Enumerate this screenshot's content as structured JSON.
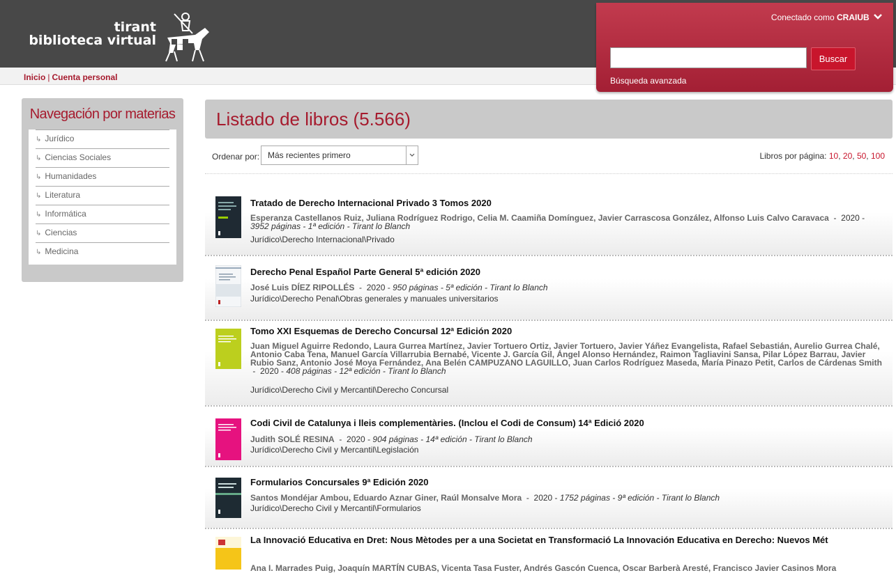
{
  "header": {
    "logo_line1": "tirant",
    "logo_line2": "biblioteca virtual",
    "user_prefix": "Conectado como",
    "user_name": "CRAIUB",
    "search_placeholder": "",
    "search_button": "Buscar",
    "advanced_search": "Búsqueda avanzada"
  },
  "breadcrumb": {
    "home": "Inicio",
    "separator": "|",
    "account": "Cuenta personal"
  },
  "sidebar": {
    "title": "Navegación por materias",
    "items": [
      {
        "label": "Jurídico"
      },
      {
        "label": "Ciencias Sociales"
      },
      {
        "label": "Humanidades"
      },
      {
        "label": "Literatura"
      },
      {
        "label": "Informática"
      },
      {
        "label": "Ciencias"
      },
      {
        "label": "Medicina"
      }
    ]
  },
  "main": {
    "title": "Listado de libros (5.566)",
    "sort_label": "Ordenar por:",
    "sort_selected": "Más recientes primero",
    "per_page_label": "Libros por página:",
    "per_page_options": [
      "10",
      "20",
      "50",
      "100"
    ]
  },
  "books": [
    {
      "title": "Tratado de Derecho Internacional Privado 3 Tomos 2020",
      "authors": "Esperanza Castellanos Ruiz,  Juliana Rodríguez Rodrigo,  Celia M. Caamiña Domínguez,  Javier Carrascosa González,  Alfonso Luis Calvo Caravaca",
      "year": "2020",
      "pages": "3952 páginas",
      "edition": "1ª edición",
      "publisher": "Tirant lo Blanch",
      "category": "Jurídico\\Derecho Internacional\\Privado",
      "cover_color": "#1f2a33"
    },
    {
      "title": "Derecho Penal Español Parte General 5ª edición 2020",
      "authors": "José Luis DÍEZ RIPOLLÉS",
      "year": "2020",
      "pages": "950 páginas",
      "edition": "5ª edición",
      "publisher": "Tirant lo Blanch",
      "category": "Jurídico\\Derecho Penal\\Obras generales y manuales universitarios",
      "cover_color": "#f4f6f8"
    },
    {
      "title": "Tomo XXI Esquemas de Derecho Concursal 12ª Edición 2020",
      "authors": "Juan Miguel Aguirre Redondo,  Laura Gurrea Martínez,  Javier Tortuero Ortiz,  Javier Tortuero,  Javier Yáñez Evangelista,  Rafael Sebastián,  Aurelio Gurrea Chalé,  Antonio Caba Tena,  Manuel García Villarrubia Bernabé,  Vicente J. García Gil,  Ángel Alonso Hernández,  Raimon Tagliavini Sansa,  Pilar López Barrau,  Javier Rubio Sanz,  Antonio José Moya Fernández,  Ana Belén CAMPUZANO LAGUILLO,  Juan Carlos Rodríguez Maseda,  María Pinazo Petit,  Carlos de Cárdenas Smith",
      "year": "2020",
      "pages": "408 páginas",
      "edition": "12ª edición",
      "publisher": "Tirant lo Blanch",
      "category": "Jurídico\\Derecho Civil y Mercantil\\Derecho Concursal",
      "cover_color": "#bccf1e"
    },
    {
      "title": "Codi Civil de Catalunya i lleis complementàries. (Inclou el Codi de Consum) 14ª Edició 2020",
      "authors": "Judith SOLÉ RESINA",
      "year": "2020",
      "pages": "904 páginas",
      "edition": "14ª edición",
      "publisher": "Tirant lo Blanch",
      "category": "Jurídico\\Derecho Civil y Mercantil\\Legislación",
      "cover_color": "#e6127f"
    },
    {
      "title": "Formularios Concursales 9ª Edición 2020",
      "authors": "Santos Mondéjar Ambou,  Eduardo Aznar Giner,  Raúl Monsalve Mora",
      "year": "2020",
      "pages": "1752 páginas",
      "edition": "9ª edición",
      "publisher": "Tirant lo Blanch",
      "category": "Jurídico\\Derecho Civil y Mercantil\\Formularios",
      "cover_color": "#1e2b33"
    },
    {
      "title": "La Innovació Educativa en Dret: Nous Mètodes per a una Societat en Transformació La Innovación Educativa en Derecho: Nuevos Mét",
      "authors": "Ana I. Marrades Puig,  Joaquín MARTÍN CUBAS,  Vicenta Tasa Fuster,  Andrés Gascón Cuenca,  Oscar Barberà Aresté,  Francisco Javier Casinos Mora",
      "cover_color": "#f5c518"
    }
  ]
}
